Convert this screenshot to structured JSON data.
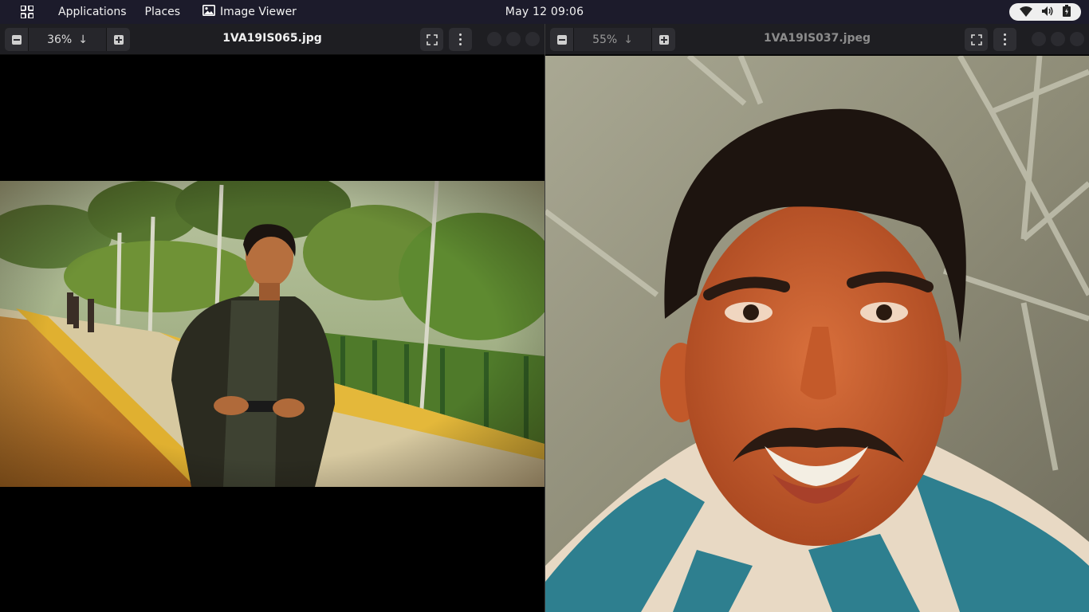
{
  "topbar": {
    "apps_label": "Applications",
    "places_label": "Places",
    "app_menu_label": "Image Viewer",
    "clock": "May 12  09:06",
    "status_icons": [
      "wifi-icon",
      "volume-icon",
      "battery-icon"
    ]
  },
  "windows": [
    {
      "title": "1VA19IS065.jpg",
      "zoom": "36%",
      "focused": true
    },
    {
      "title": "1VA19IS037.jpeg",
      "zoom": "55%",
      "focused": false
    }
  ],
  "colors": {
    "topbar_bg": "#1c1b2b",
    "headerbar_bg": "#1e1e22",
    "button_bg": "#2e2e33",
    "status_pill": "#efefef"
  }
}
